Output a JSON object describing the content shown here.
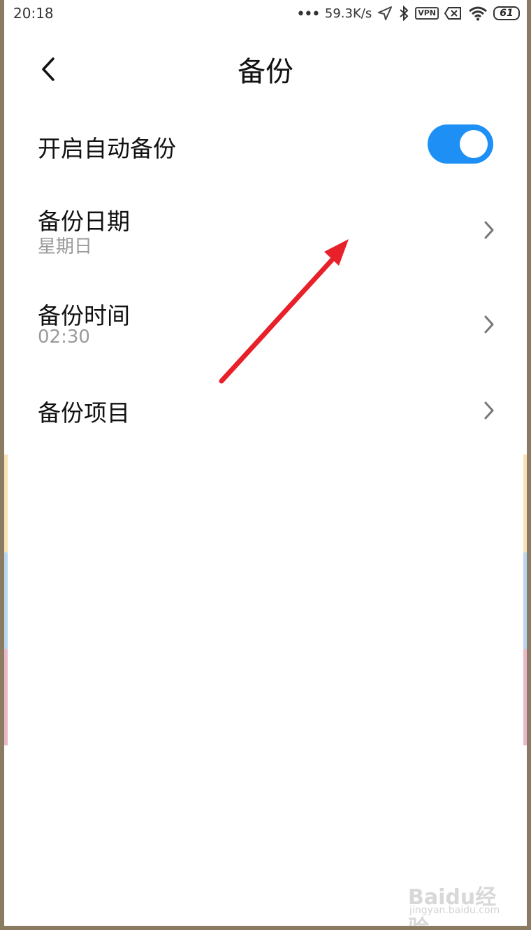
{
  "status_bar": {
    "time": "20:18",
    "net_speed": "59.3K/s",
    "vpn_label": "VPN",
    "battery": "61",
    "icons": [
      "more-dots-icon",
      "location-icon",
      "bluetooth-icon",
      "vpn-icon",
      "sim-off-icon",
      "wifi-icon",
      "battery-icon"
    ]
  },
  "header": {
    "title": "备份",
    "back_icon": "back-arrow-icon"
  },
  "settings": {
    "auto_backup": {
      "label": "开启自动备份",
      "enabled": true
    },
    "backup_date": {
      "label": "备份日期",
      "value": "星期日"
    },
    "backup_time": {
      "label": "备份时间",
      "value": "02:30"
    },
    "backup_items": {
      "label": "备份项目"
    }
  },
  "annotation": {
    "arrow_color": "#e8202a"
  },
  "watermark": {
    "logo": "Baidu经验",
    "url": "jingyan.baidu.com"
  },
  "colors": {
    "accent": "#1e90f5",
    "text_primary": "#111111",
    "text_secondary": "#9a9a9a"
  }
}
